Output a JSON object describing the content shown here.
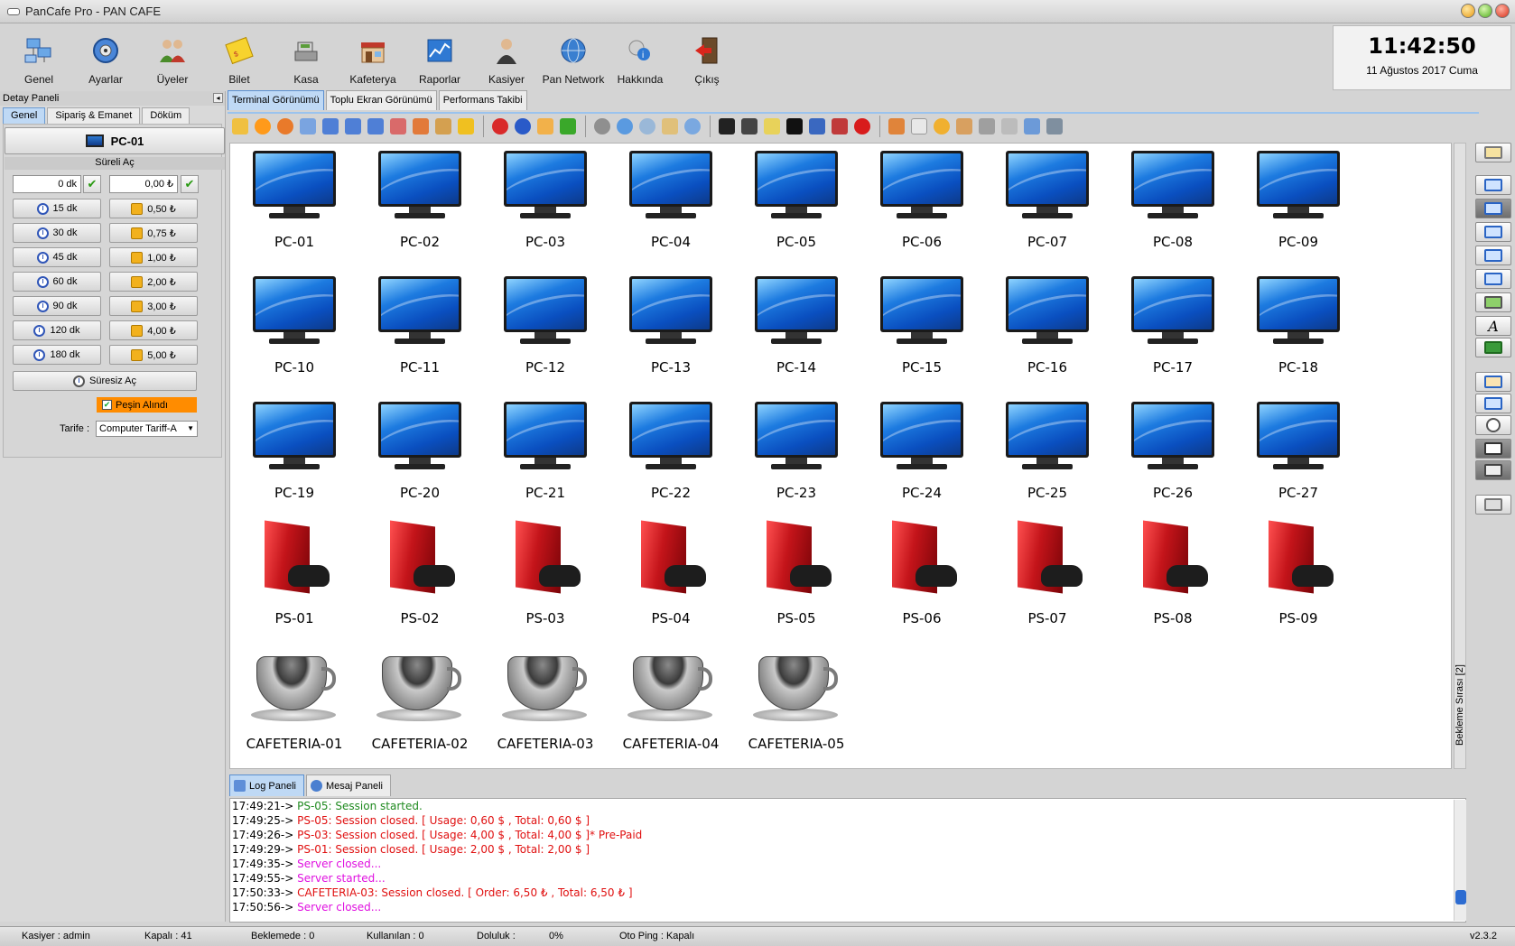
{
  "window": {
    "title": "PanCafe Pro - PAN CAFE"
  },
  "toolbar": [
    {
      "label": "Genel",
      "icon": "network-computers-icon"
    },
    {
      "label": "Ayarlar",
      "icon": "settings-gear-icon"
    },
    {
      "label": "Üyeler",
      "icon": "users-icon"
    },
    {
      "label": "Bilet",
      "icon": "ticket-icon"
    },
    {
      "label": "Kasa",
      "icon": "cash-register-icon"
    },
    {
      "label": "Kafeterya",
      "icon": "store-icon"
    },
    {
      "label": "Raporlar",
      "icon": "reports-chart-icon"
    },
    {
      "label": "Kasiyer",
      "icon": "cashier-person-icon"
    },
    {
      "label": "Pan Network",
      "icon": "globe-icon"
    },
    {
      "label": "Hakkında",
      "icon": "info-icon"
    },
    {
      "label": "Çıkış",
      "icon": "exit-door-icon"
    }
  ],
  "clock": {
    "time": "11:42:50",
    "date": "11 Ağustos 2017 Cuma"
  },
  "left_panel": {
    "header": "Detay Paneli",
    "tabs": [
      "Genel",
      "Sipariş & Emanet",
      "Döküm"
    ],
    "active_tab": 0,
    "selected_pc": "PC-01",
    "sureli_label": "Süreli Aç",
    "minutes_input": "0 dk",
    "amount_input": "0,00 ₺",
    "time_buttons": [
      "15 dk",
      "30 dk",
      "45 dk",
      "60 dk",
      "90 dk",
      "120 dk",
      "180 dk"
    ],
    "money_buttons": [
      "0,50 ₺",
      "0,75 ₺",
      "1,00 ₺",
      "2,00 ₺",
      "3,00 ₺",
      "4,00 ₺",
      "5,00 ₺"
    ],
    "unlimited_button": "Süresiz Aç",
    "prepaid_label": "Peşin Alındı",
    "prepaid_checked": true,
    "tariff_label": "Tarife :",
    "tariff_value": "Computer Tariff-A"
  },
  "center_tabs": [
    "Terminal Görünümü",
    "Toplu Ekran Görünümü",
    "Performans Takibi"
  ],
  "center_active_tab": 0,
  "terminals": {
    "pcs": [
      "PC-01",
      "PC-02",
      "PC-03",
      "PC-04",
      "PC-05",
      "PC-06",
      "PC-07",
      "PC-08",
      "PC-09",
      "PC-10",
      "PC-11",
      "PC-12",
      "PC-13",
      "PC-14",
      "PC-15",
      "PC-16",
      "PC-17",
      "PC-18",
      "PC-19",
      "PC-20",
      "PC-21",
      "PC-22",
      "PC-23",
      "PC-24",
      "PC-25",
      "PC-26",
      "PC-27"
    ],
    "playstations": [
      "PS-01",
      "PS-02",
      "PS-03",
      "PS-04",
      "PS-05",
      "PS-06",
      "PS-07",
      "PS-08",
      "PS-09"
    ],
    "cafeterias": [
      "CAFETERIA-01",
      "CAFETERIA-02",
      "CAFETERIA-03",
      "CAFETERIA-04",
      "CAFETERIA-05"
    ]
  },
  "waiting_queue_label": "Bekleme Sırası [2]",
  "bottom_tabs": [
    "Log Paneli",
    "Mesaj Paneli"
  ],
  "log": [
    {
      "time": "17:49:21-> ",
      "text": "PS-05: Session started.",
      "color": "#1f8a1f"
    },
    {
      "time": "17:49:25-> ",
      "text": "PS-05: Session closed. [ Usage: 0,60 $ , Total: 0,60 $ ]",
      "color": "#e01010"
    },
    {
      "time": "17:49:26-> ",
      "text": "PS-03: Session closed. [ Usage: 4,00 $ , Total: 4,00 $ ]* Pre-Paid",
      "color": "#e01010"
    },
    {
      "time": "17:49:29-> ",
      "text": "PS-01: Session closed. [ Usage: 2,00 $ , Total: 2,00 $ ]",
      "color": "#e01010"
    },
    {
      "time": "17:49:35-> ",
      "text": "Server closed...",
      "color": "#e010e0"
    },
    {
      "time": "17:49:55-> ",
      "text": "Server started...",
      "color": "#e010e0"
    },
    {
      "time": "17:50:33-> ",
      "text": "CAFETERIA-03: Session closed. [ Order: 6,50 ₺ , Total: 6,50 ₺ ]",
      "color": "#e01010"
    },
    {
      "time": "17:50:56-> ",
      "text": "Server closed...",
      "color": "#e010e0"
    }
  ],
  "status": {
    "cashier": "Kasiyer : admin",
    "closed": "Kapalı : 41",
    "waiting": "Beklemede : 0",
    "used": "Kullanılan : 0",
    "occupancy_label": "Doluluk :",
    "occupancy_value": "0%",
    "auto_ping": "Oto Ping : Kapalı",
    "version": "v2.3.2"
  }
}
